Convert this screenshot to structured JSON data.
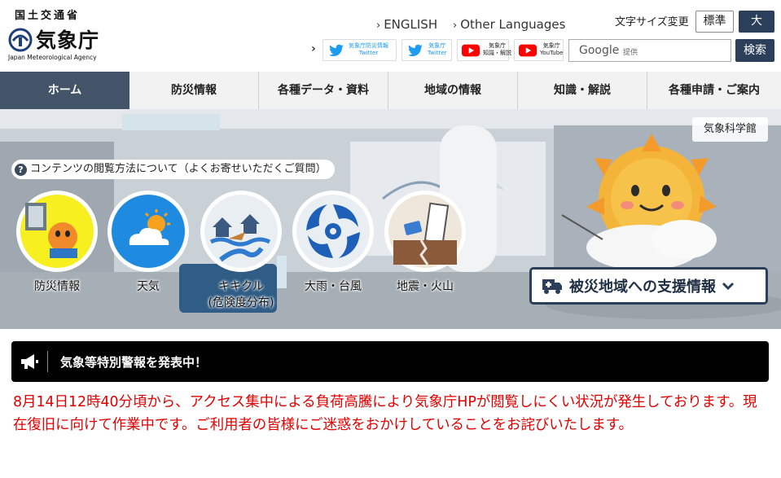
{
  "header": {
    "logo": {
      "ministry": "国土交通省",
      "name": "気象庁",
      "name_en": "Japan Meteorological Agency"
    },
    "lang_links": [
      "ENGLISH",
      "Other Languages"
    ],
    "font_size": {
      "label": "文字サイズ変更",
      "standard": "標準",
      "large": "大"
    },
    "sns": [
      {
        "label_line1": "気象庁防災情報",
        "label_line2": "Twitter",
        "icon": "twitter-bird-icon",
        "color": "#1d9bf0"
      },
      {
        "label_line1": "気象庁",
        "label_line2": "Twitter",
        "icon": "twitter-bird-icon",
        "color": "#1d9bf0"
      },
      {
        "label_line1": "気象庁",
        "label_line2": "知識・解説",
        "icon": "youtube-play-icon",
        "color": "#ff0000"
      },
      {
        "label_line1": "気象庁",
        "label_line2": "YouTube",
        "icon": "youtube-play-icon",
        "color": "#ff0000"
      }
    ],
    "search": {
      "google_label": "Google",
      "provided_label": "提供",
      "button": "検索"
    }
  },
  "nav": {
    "items": [
      "ホーム",
      "防災情報",
      "各種データ・資料",
      "地域の情報",
      "知識・解説",
      "各種申請・ご案内"
    ],
    "active_color": "#435468"
  },
  "hero": {
    "museum_label": "気象科学館",
    "faq_icon": "?",
    "faq_text": "コンテンツの閲覧方法について（よくお寄せいただくご質問）",
    "categories": [
      {
        "label": "防災情報",
        "icon": "disaster-prevention-icon"
      },
      {
        "label": "天気",
        "icon": "sun-cloud-icon"
      },
      {
        "label": "キキクル\n(危険度分布)",
        "label_line1": "キキクル",
        "label_line2": "(危険度分布)",
        "icon": "kikikuru-flood-icon"
      },
      {
        "label": "大雨・台風",
        "icon": "typhoon-icon"
      },
      {
        "label": "地震・火山",
        "icon": "earthquake-icon"
      }
    ],
    "support_button": "被災地域への支援情報"
  },
  "alert": {
    "title": "気象等特別警報を発表中！",
    "icon": "megaphone-icon"
  },
  "notice": {
    "text": "8月14日12時40分頃から、アクセス集中による負荷高騰により気象庁HPが閲覧しにくい状況が発生しております。現在復旧に向けて作業中です。ご利用者の皆様にご迷惑をおかけしていることをお詫びいたします。",
    "color": "#e00000"
  }
}
